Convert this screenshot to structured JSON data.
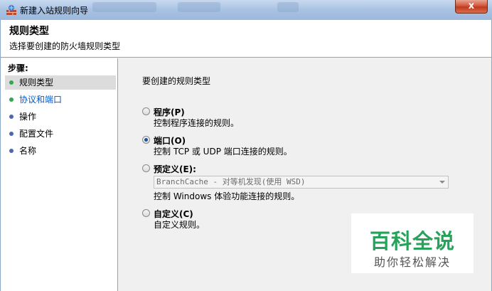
{
  "window": {
    "title": "新建入站规则向导",
    "close_label": "x"
  },
  "header": {
    "title": "规则类型",
    "subtitle": "选择要创建的防火墙规则类型"
  },
  "steps": {
    "heading": "步骤:",
    "items": [
      {
        "label": "规则类型",
        "state": "active",
        "dot_color": "#2fa84f"
      },
      {
        "label": "协议和端口",
        "state": "current",
        "dot_color": "#2fa84f"
      },
      {
        "label": "操作",
        "state": "pending",
        "dot_color": "#4a67b8"
      },
      {
        "label": "配置文件",
        "state": "pending",
        "dot_color": "#4a67b8"
      },
      {
        "label": "名称",
        "state": "pending",
        "dot_color": "#4a67b8"
      }
    ]
  },
  "main": {
    "prompt": "要创建的规则类型",
    "options": [
      {
        "label": "程序(P)",
        "description": "控制程序连接的规则。",
        "checked": false
      },
      {
        "label": "端口(O)",
        "description": "控制 TCP 或 UDP 端口连接的规则。",
        "checked": true
      },
      {
        "label": "预定义(E):",
        "description": "",
        "checked": false
      },
      {
        "label": "自定义(C)",
        "description": "自定义规则。",
        "checked": false
      }
    ],
    "predefined_select": {
      "value": "BranchCache - 对等机发现(使用 WSD)",
      "description": "控制 Windows 体验功能连接的规则。"
    }
  },
  "watermark": {
    "line1": "百科全说",
    "line2": "助你轻松解决",
    "color": "#27a25b"
  }
}
